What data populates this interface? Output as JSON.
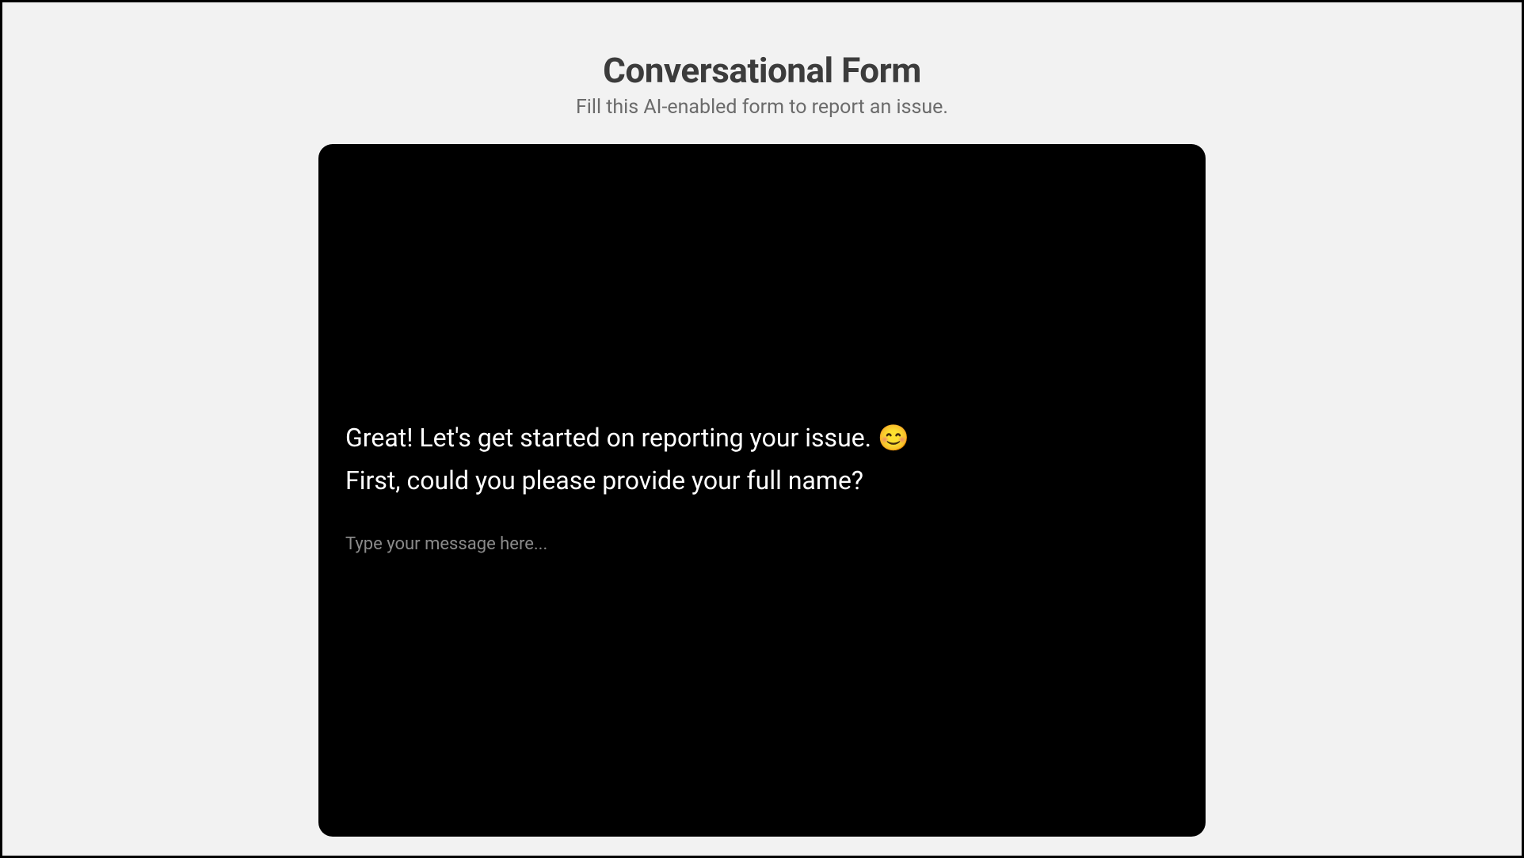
{
  "header": {
    "title": "Conversational Form",
    "subtitle": "Fill this AI-enabled form to report an issue."
  },
  "chat": {
    "assistant_message": "Great! Let's get started on reporting your issue. 😊\nFirst, could you please provide your full name?",
    "input_placeholder": "Type your message here...",
    "input_value": ""
  }
}
